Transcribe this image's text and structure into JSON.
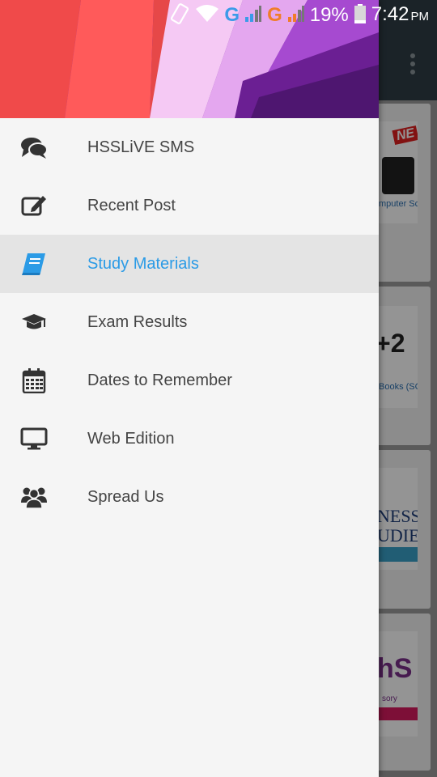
{
  "status_bar": {
    "network_1": "G",
    "network_2": "G",
    "battery_percent": "19%",
    "time": "7:42",
    "time_suffix": "PM"
  },
  "colors": {
    "accent": "#2b9be6",
    "drawer_bg": "#f5f5f5",
    "selected_bg": "#e4e4e4",
    "toolbar": "#2f3d45"
  },
  "drawer": {
    "items": [
      {
        "label": "HSSLiVE SMS",
        "icon": "comments-icon"
      },
      {
        "label": "Recent Post",
        "icon": "edit-icon"
      },
      {
        "label": "Study Materials",
        "icon": "book-icon",
        "selected": true
      },
      {
        "label": "Exam Results",
        "icon": "graduation-cap-icon"
      },
      {
        "label": "Dates to Remember",
        "icon": "calendar-icon"
      },
      {
        "label": "Web Edition",
        "icon": "desktop-icon"
      },
      {
        "label": "Spread Us",
        "icon": "users-icon"
      }
    ]
  },
  "background": {
    "cards": [
      {
        "badge": "NE",
        "caption": "mputer Sc"
      },
      {
        "badge": "+2",
        "caption": "Books (SCE"
      },
      {
        "badge": "NESS\nUDIE",
        "caption": ""
      },
      {
        "badge": "hS",
        "caption": "sory"
      }
    ]
  }
}
